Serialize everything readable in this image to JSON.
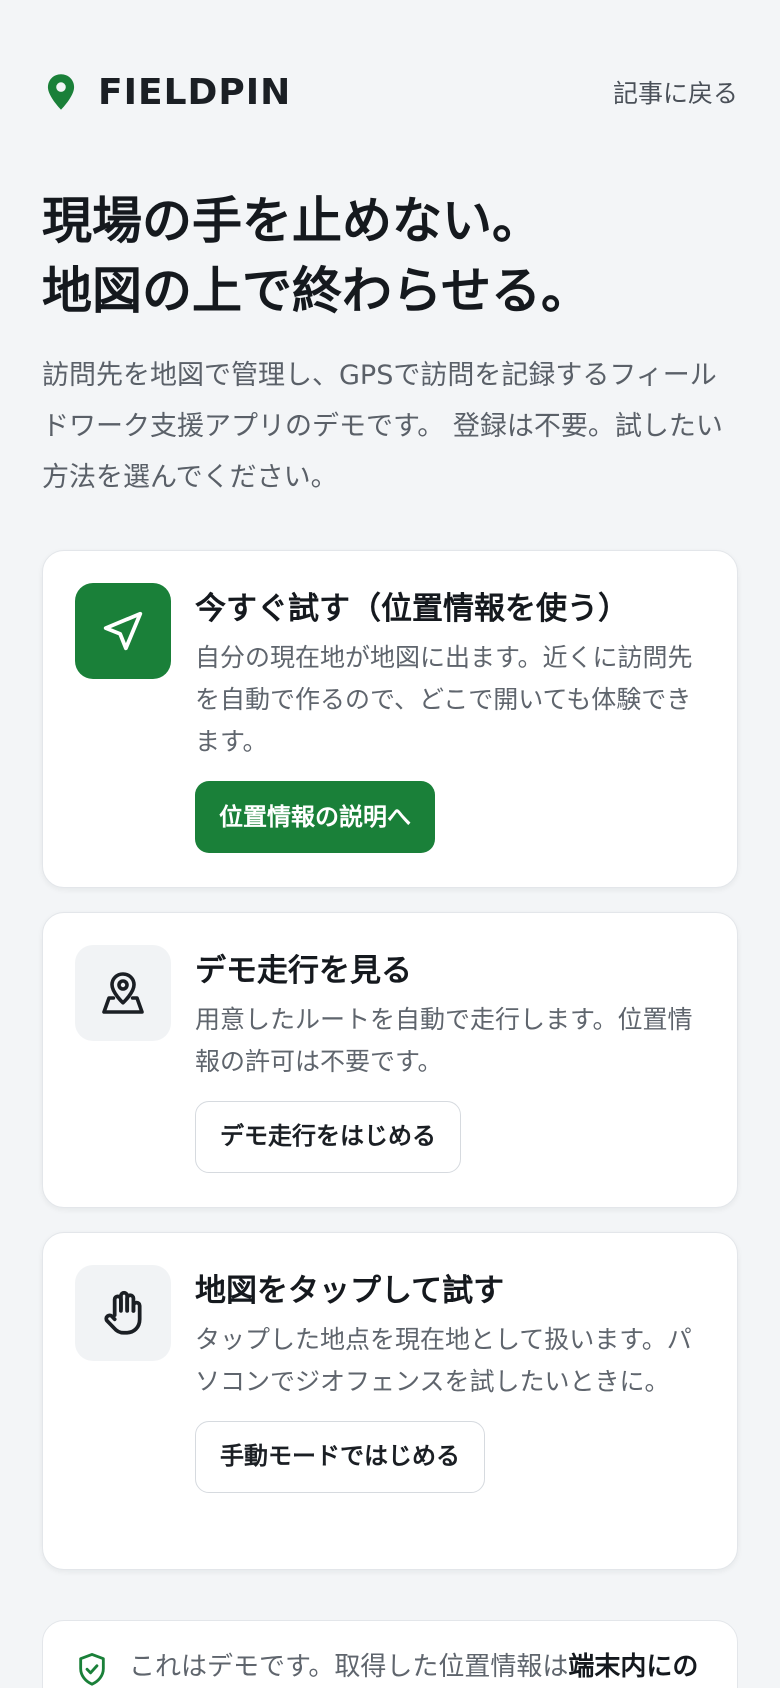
{
  "colors": {
    "brand_green": "#1a8039",
    "background": "#f3f5f7",
    "card_background": "#ffffff",
    "text_primary": "#15191e",
    "text_secondary": "#5f656d"
  },
  "header": {
    "brand_icon": "map-pin-icon",
    "brand_name": "FIELDPIN",
    "back_link_label": "記事に戻る"
  },
  "hero": {
    "title_line1": "現場の手を止めない。",
    "title_line2": "地図の上で終わらせる。",
    "description": "訪問先を地図で管理し、GPSで訪問を記録するフィールドワーク支援アプリのデモです。 登録は不要。試したい方法を選んでください。"
  },
  "options": [
    {
      "icon": "navigation-arrow-icon",
      "title": "今すぐ試す（位置情報を使う）",
      "description": "自分の現在地が地図に出ます。近くに訪問先を自動で作るので、どこで開いても体験できます。",
      "button_label": "位置情報の説明へ"
    },
    {
      "icon": "map-pin-person-icon",
      "title": "デモ走行を見る",
      "description": "用意したルートを自動で走行します。位置情報の許可は不要です。",
      "button_label": "デモ走行をはじめる"
    },
    {
      "icon": "hand-tap-icon",
      "title": "地図をタップして試す",
      "description": "タップした地点を現在地として扱います。パソコンでジオフェンスを試したいときに。",
      "button_label": "手動モードではじめる"
    }
  ],
  "notice": {
    "icon": "shield-check-icon",
    "text_prefix": "これはデモです。取得した位置情報は",
    "text_emphasis": "端末内にの"
  }
}
